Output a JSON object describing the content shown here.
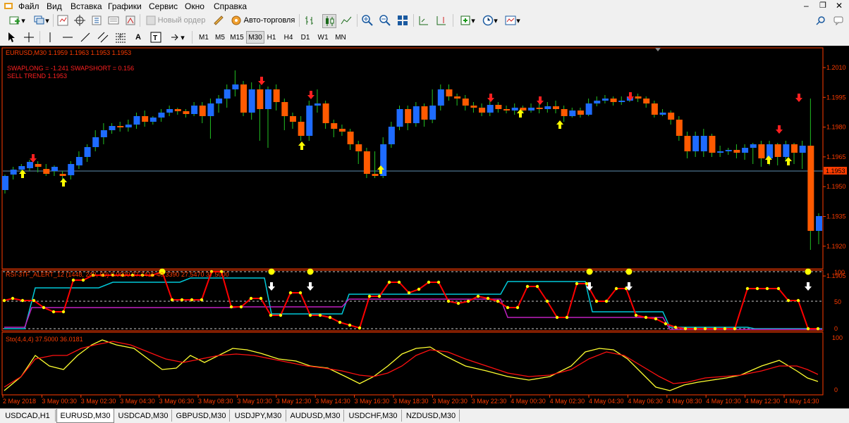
{
  "menu": [
    "Файл",
    "Вид",
    "Вставка",
    "Графики",
    "Сервис",
    "Окно",
    "Справка"
  ],
  "toolbar": {
    "new_order_label": "Новый ордер",
    "autotrading_label": "Авто-торговля"
  },
  "timeframes": [
    "M1",
    "M5",
    "M15",
    "M30",
    "H1",
    "H4",
    "D1",
    "W1",
    "MN"
  ],
  "active_timeframe": "M30",
  "chart": {
    "symbol_line": "EURUSD,M30  1.1959 1.1963 1.1953 1.1953",
    "swap_line": "SWAPLONG = -1.241   SWAPSHORT = 0.156",
    "trend_line": "SELL TREND 1.1953",
    "price_ticks": [
      "1.2010",
      "1.1995",
      "1.1980",
      "1.1965",
      "1.1950",
      "1.1935",
      "1.1920",
      "1.1905"
    ],
    "current_price": "1.1953",
    "rsi_label": "RSI-3TF_ALERT_12 (1448, 240, 60) 0.0000 37.7416 40.3390 27.5470 37.5000",
    "rsi_ticks": [
      "100",
      "50",
      "0"
    ],
    "sto_label": "Sto(4,4,4) 37.5000 36.0181",
    "sto_ticks": [
      "100",
      "0"
    ],
    "time_labels": [
      "2 May 2018",
      "3 May 00:30",
      "3 May 02:30",
      "3 May 04:30",
      "3 May 06:30",
      "3 May 08:30",
      "3 May 10:30",
      "3 May 12:30",
      "3 May 14:30",
      "3 May 16:30",
      "3 May 18:30",
      "3 May 20:30",
      "3 May 22:30",
      "4 May 00:30",
      "4 May 02:30",
      "4 May 04:30",
      "4 May 06:30",
      "4 May 08:30",
      "4 May 10:30",
      "4 May 12:30",
      "4 May 14:30"
    ]
  },
  "colors": {
    "bull": "#1e6bff",
    "bear": "#ff5a00",
    "wick": "#22c022",
    "sell_arrow": "#ff2020",
    "buy_arrow": "#ffff00",
    "rsi_red": "#ff0000",
    "rsi_cyan": "#00c8d8",
    "rsi_magenta": "#c020c0",
    "sto_main": "#ffff30",
    "sto_signal": "#ff1010",
    "axis": "#ff3c00"
  },
  "tabs": [
    "USDCAD,H1",
    "EURUSD,M30",
    "USDCAD,M30",
    "GBPUSD,M30",
    "USDJPY,M30",
    "AUDUSD,M30",
    "USDCHF,M30",
    "NZDUSD,M30"
  ],
  "active_tab": "EURUSD,M30"
}
